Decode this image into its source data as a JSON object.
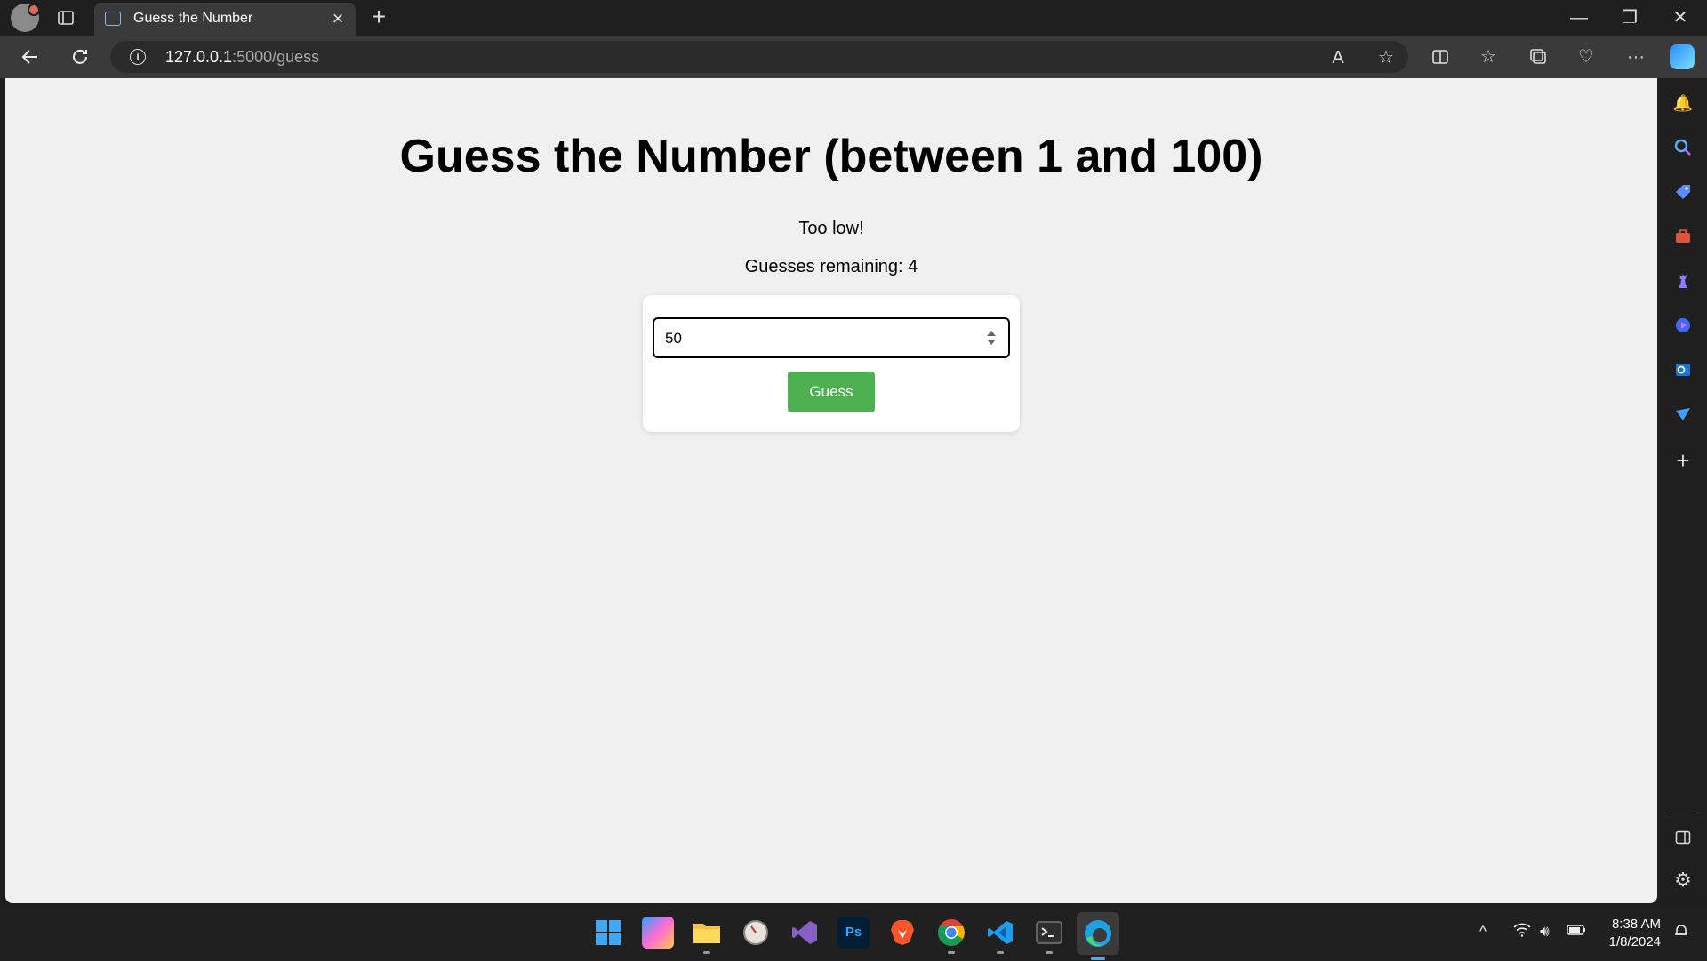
{
  "browser": {
    "tab": {
      "title": "Guess the Number",
      "close": "×"
    },
    "new_tab": "+",
    "window_controls": {
      "minimize": "—",
      "restore": "❐",
      "close": "✕"
    },
    "address": {
      "host": "127.0.0.1",
      "path": ":5000/guess"
    },
    "read_aloud": "A",
    "more": "···"
  },
  "page": {
    "heading": "Guess the Number (between 1 and 100)",
    "feedback": "Too low!",
    "remaining": "Guesses remaining: 4",
    "input_value": "50",
    "guess_button": "Guess"
  },
  "sidebar": {
    "add": "+"
  },
  "taskbar": {
    "apps": [
      "start-icon",
      "copilot-pre-icon",
      "file-explorer-icon",
      "clock-app-icon",
      "visual-studio-icon",
      "photoshop-icon",
      "brave-icon",
      "chrome-icon",
      "vscode-icon",
      "terminal-icon",
      "edge-icon"
    ],
    "photoshop_label": "Ps",
    "time": "8:38 AM",
    "date": "1/8/2024"
  }
}
